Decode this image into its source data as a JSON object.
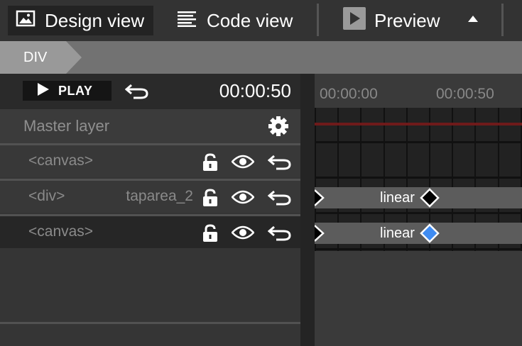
{
  "toolbar": {
    "design_view": "Design view",
    "code_view": "Code view",
    "preview": "Preview"
  },
  "breadcrumb": {
    "current": "DIV"
  },
  "transport": {
    "play_label": "PLAY",
    "current_time": "00:00:50"
  },
  "layers": {
    "master_label": "Master layer",
    "items": [
      {
        "name": "<canvas>",
        "id": "",
        "selected": false
      },
      {
        "name": "<div>",
        "id": "taparea_2",
        "selected": false
      },
      {
        "name": "<canvas>",
        "id": "",
        "selected": true
      }
    ]
  },
  "timeline": {
    "ticks": [
      "00:00:00",
      "00:00:50"
    ],
    "tracks": [
      {
        "easing": "linear",
        "keyframe_color": "#000000"
      },
      {
        "easing": "linear",
        "keyframe_color": "#3f8cf2"
      }
    ]
  },
  "colors": {
    "playhead": "#6e1a1a",
    "selected_keyframe": "#3f8cf2",
    "active_tab_bg": "#232323"
  },
  "icons": {
    "design_view": "image-icon",
    "code_view": "lines-icon",
    "preview": "play-square-icon",
    "menu": "triangle-up-icon",
    "play": "play-icon",
    "undo": "undo-icon",
    "settings": "gear-icon",
    "lock": "unlock-icon",
    "visibility": "eye-icon",
    "revert": "revert-icon"
  }
}
